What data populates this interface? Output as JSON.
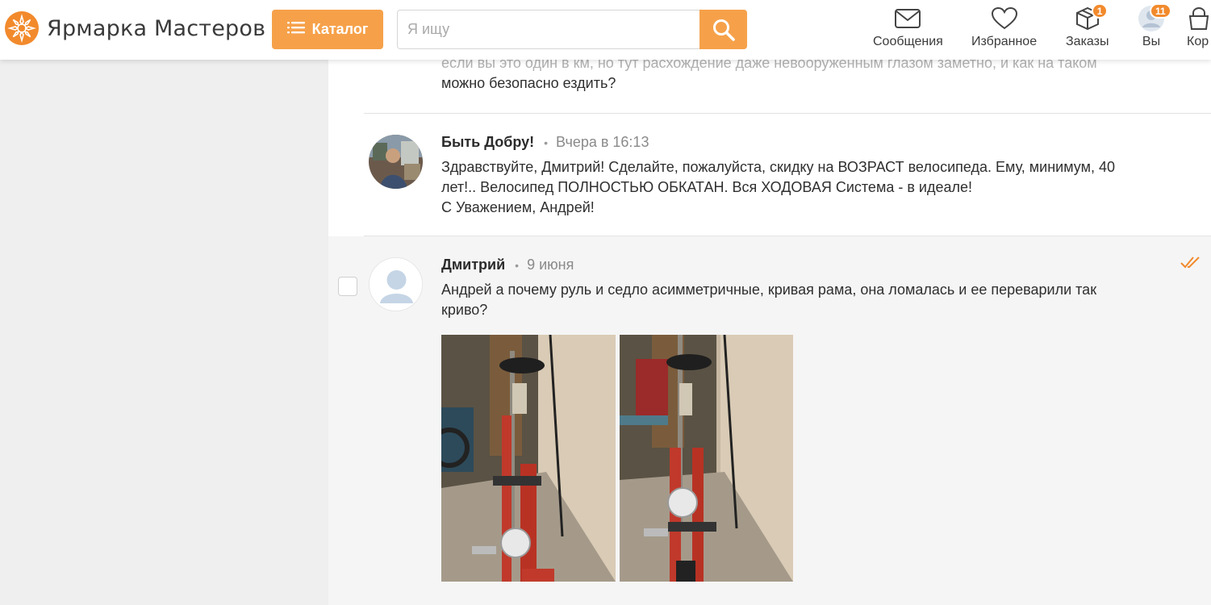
{
  "header": {
    "brand": "Ярмарка Мастеров",
    "catalog_label": "Каталог",
    "search_placeholder": "Я ищу",
    "nav": [
      {
        "label": "Сообщения",
        "icon": "envelope-icon"
      },
      {
        "label": "Избранное",
        "icon": "heart-icon"
      },
      {
        "label": "Заказы",
        "icon": "box-icon",
        "badge": "1"
      },
      {
        "label": "Вы",
        "icon": "user-icon",
        "badge": "11"
      },
      {
        "label": "Кор",
        "icon": "cart-icon"
      }
    ]
  },
  "messages": {
    "partial": {
      "text_cut": "если вы это один в км, но тут расхождение даже невооруженным глазом заметно, и как на таком",
      "text_last": "можно безопасно ездить?"
    },
    "items": [
      {
        "author": "Быть Добру!",
        "time": "Вчера в 16:13",
        "lines": [
          "Здравствуйте, Дмитрий! Сделайте, пожалуйста, скидку на ВОЗРАСТ велосипеда. Ему, минимум, 40",
          "лет!.. Велосипед ПОЛНОСТЬЮ ОБКАТАН. Вся ХОДОВАЯ Система - в идеале!",
          "С Уважением, Андрей!"
        ]
      },
      {
        "author": "Дмитрий",
        "time": "9 июня",
        "lines": [
          "Андрей а почему руль и седло асимметричные, кривая рама, она ломалась и ее переварили так",
          "криво?"
        ],
        "photos": [
          "bicycle-photo-1",
          "bicycle-photo-2"
        ]
      }
    ]
  },
  "colors": {
    "accent": "#f6a14a",
    "brand_orange": "#f28a2c",
    "read_check": "#f28a2c"
  }
}
